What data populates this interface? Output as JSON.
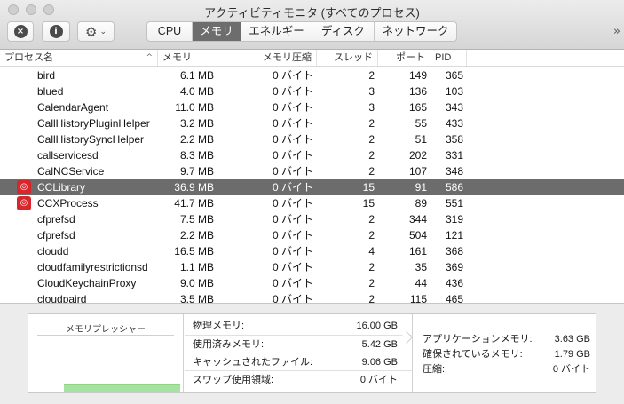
{
  "window": {
    "title": "アクティビティモニタ (すべてのプロセス)"
  },
  "toolbar": {
    "stop_icon": "×",
    "info_icon": "i",
    "gear_icon": "⚙",
    "chevron_icon": "⌄",
    "tabs": [
      {
        "label": "CPU",
        "active": false
      },
      {
        "label": "メモリ",
        "active": true
      },
      {
        "label": "エネルギー",
        "active": false
      },
      {
        "label": "ディスク",
        "active": false
      },
      {
        "label": "ネットワーク",
        "active": false
      }
    ],
    "overflow_icon": "»"
  },
  "table": {
    "headers": [
      "プロセス名",
      "メモリ",
      "メモリ圧縮",
      "スレッド",
      "ポート",
      "PID"
    ],
    "sort_indicator": "^",
    "rows": [
      {
        "name": "bird",
        "memory": "6.1 MB",
        "compressed": "0 バイト",
        "threads": "2",
        "ports": "149",
        "pid": "365"
      },
      {
        "name": "blued",
        "memory": "4.0 MB",
        "compressed": "0 バイト",
        "threads": "3",
        "ports": "136",
        "pid": "103"
      },
      {
        "name": "CalendarAgent",
        "memory": "11.0 MB",
        "compressed": "0 バイト",
        "threads": "3",
        "ports": "165",
        "pid": "343"
      },
      {
        "name": "CallHistoryPluginHelper",
        "memory": "3.2 MB",
        "compressed": "0 バイト",
        "threads": "2",
        "ports": "55",
        "pid": "433"
      },
      {
        "name": "CallHistorySyncHelper",
        "memory": "2.2 MB",
        "compressed": "0 バイト",
        "threads": "2",
        "ports": "51",
        "pid": "358"
      },
      {
        "name": "callservicesd",
        "memory": "8.3 MB",
        "compressed": "0 バイト",
        "threads": "2",
        "ports": "202",
        "pid": "331"
      },
      {
        "name": "CalNCService",
        "memory": "9.7 MB",
        "compressed": "0 バイト",
        "threads": "2",
        "ports": "107",
        "pid": "348"
      },
      {
        "name": "CCLibrary",
        "memory": "36.9 MB",
        "compressed": "0 バイト",
        "threads": "15",
        "ports": "91",
        "pid": "586",
        "selected": true,
        "icon": "creative-cloud-icon"
      },
      {
        "name": "CCXProcess",
        "memory": "41.7 MB",
        "compressed": "0 バイト",
        "threads": "15",
        "ports": "89",
        "pid": "551",
        "icon": "creative-cloud-icon"
      },
      {
        "name": "cfprefsd",
        "memory": "7.5 MB",
        "compressed": "0 バイト",
        "threads": "2",
        "ports": "344",
        "pid": "319"
      },
      {
        "name": "cfprefsd",
        "memory": "2.2 MB",
        "compressed": "0 バイト",
        "threads": "2",
        "ports": "504",
        "pid": "121"
      },
      {
        "name": "cloudd",
        "memory": "16.5 MB",
        "compressed": "0 バイト",
        "threads": "4",
        "ports": "161",
        "pid": "368"
      },
      {
        "name": "cloudfamilyrestrictionsd",
        "memory": "1.1 MB",
        "compressed": "0 バイト",
        "threads": "2",
        "ports": "35",
        "pid": "369"
      },
      {
        "name": "CloudKeychainProxy",
        "memory": "9.0 MB",
        "compressed": "0 バイト",
        "threads": "2",
        "ports": "44",
        "pid": "436"
      },
      {
        "name": "cloudpaird",
        "memory": "3.5 MB",
        "compressed": "0 バイト",
        "threads": "2",
        "ports": "115",
        "pid": "465"
      }
    ]
  },
  "summary": {
    "pressure_title": "メモリプレッシャー",
    "pressure_level": 0.82,
    "pressure_color": "#a6e3a0",
    "stats": [
      {
        "label": "物理メモリ:",
        "value": "16.00 GB"
      },
      {
        "label": "使用済みメモリ:",
        "value": "5.42 GB"
      },
      {
        "label": "キャッシュされたファイル:",
        "value": "9.06 GB"
      },
      {
        "label": "スワップ使用領域:",
        "value": "0 バイト"
      }
    ],
    "detail": [
      {
        "label": "アプリケーションメモリ:",
        "value": "3.63 GB"
      },
      {
        "label": "確保されているメモリ:",
        "value": "1.79 GB"
      },
      {
        "label": "圧縮:",
        "value": "0 バイト"
      }
    ]
  }
}
